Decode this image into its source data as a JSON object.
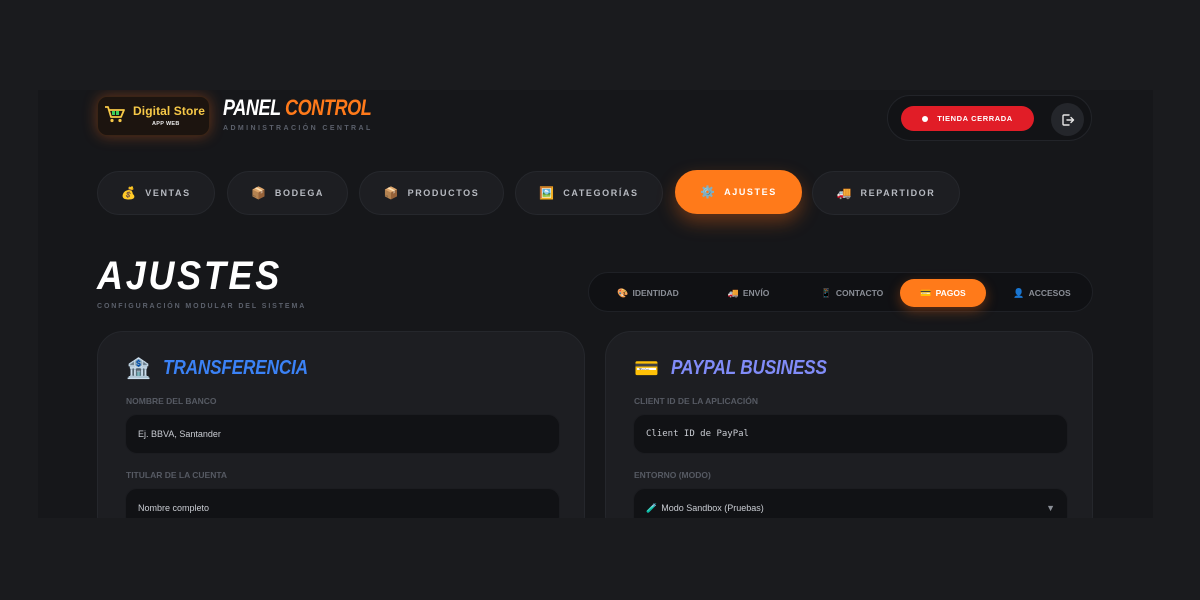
{
  "header": {
    "logo_title": "Digital Store",
    "logo_sub": "APP WEB",
    "title_white": "PANEL",
    "title_orange": "CONTROL",
    "subtitle": "ADMINISTRACIÓN CENTRAL",
    "status_label": "TIENDA CERRADA",
    "status_color": "#e11d27"
  },
  "nav": [
    {
      "icon": "💰",
      "label": "VENTAS"
    },
    {
      "icon": "📦",
      "label": "BODEGA"
    },
    {
      "icon": "📦",
      "label": "PRODUCTOS"
    },
    {
      "icon": "🖼️",
      "label": "CATEGORÍAS"
    },
    {
      "icon": "⚙️",
      "label": "AJUSTES",
      "active": true
    },
    {
      "icon": "🚚",
      "label": "REPARTIDOR"
    }
  ],
  "page": {
    "title": "AJUSTES",
    "subtitle": "CONFIGURACIÓN MODULAR DEL SISTEMA"
  },
  "subtabs": [
    {
      "icon": "🎨",
      "label": "IDENTIDAD"
    },
    {
      "icon": "🚚",
      "label": "ENVÍO"
    },
    {
      "icon": "📱",
      "label": "CONTACTO"
    },
    {
      "icon": "💳",
      "label": "PAGOS",
      "active": true
    },
    {
      "icon": "👤",
      "label": "ACCESOS"
    }
  ],
  "transfer": {
    "icon": "🏦",
    "title": "TRANSFERENCIA",
    "title_color": "#3b82f6",
    "bank_label": "NOMBRE DEL BANCO",
    "bank_placeholder": "Ej. BBVA, Santander",
    "holder_label": "TITULAR DE LA CUENTA",
    "holder_placeholder": "Nombre completo"
  },
  "paypal": {
    "icon": "💳",
    "title": "PAYPAL BUSINESS",
    "title_color": "#818cf8",
    "client_label": "CLIENT ID DE LA APLICACIÓN",
    "client_placeholder": "Client ID de PayPal",
    "env_label": "ENTORNO (MODO)",
    "env_icon": "🧪",
    "env_value": "Modo Sandbox (Pruebas)"
  },
  "accent": "#ff7a1a"
}
